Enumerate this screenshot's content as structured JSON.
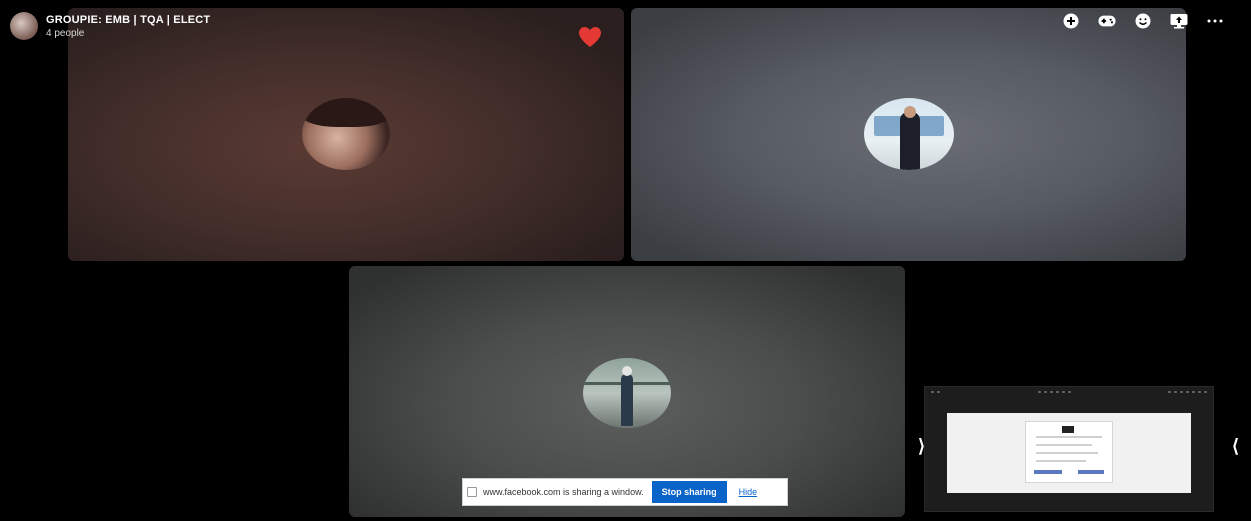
{
  "header": {
    "title": "GROUPIE: EMB | TQA | ELECT",
    "subtitle": "4 people",
    "avatar_icon": "group-avatar-icon"
  },
  "toolbar": {
    "items": [
      {
        "icon": "add-circle-icon"
      },
      {
        "icon": "gamepad-icon"
      },
      {
        "icon": "emoji-icon"
      },
      {
        "icon": "screen-share-icon"
      },
      {
        "icon": "more-options-icon"
      }
    ]
  },
  "reaction": {
    "icon": "heart-icon",
    "color": "#e53935"
  },
  "participants": [
    {
      "tile": "participant-tile-1"
    },
    {
      "tile": "participant-tile-2"
    },
    {
      "tile": "participant-tile-3"
    }
  ],
  "share_preview": {
    "nav_prev_icon": "chevron-right-icon",
    "nav_next_icon": "chevron-left-icon"
  },
  "share_bar": {
    "message": "www.facebook.com is sharing a window.",
    "stop_label": "Stop sharing",
    "hide_label": "Hide",
    "accent_color": "#0a63c9"
  }
}
